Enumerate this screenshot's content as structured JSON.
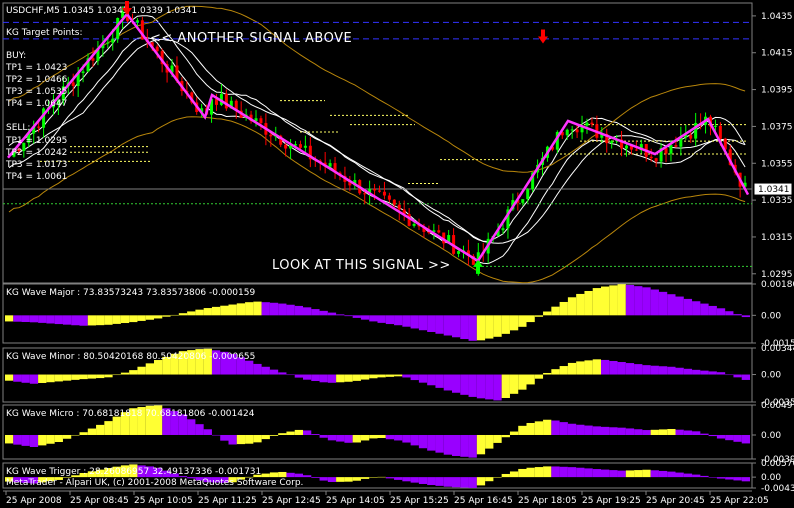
{
  "chart_data": [
    {
      "type": "candlestick",
      "title": "USDCHF,M5  1.0345 1.0345 1.0339 1.0341",
      "price_axis": {
        "ticks": [
          "1.0435",
          "1.0415",
          "1.0395",
          "1.0375",
          "1.0355",
          "1.0335",
          "1.0315",
          "1.0295"
        ],
        "ylim": [
          1.029,
          1.0442
        ],
        "current_price": "1.0341"
      },
      "target_box": {
        "title": "KG Target Points:",
        "buy_header": "BUY:",
        "buy": [
          "TP1 = 1.0423",
          "TP2 = 1.0466",
          "TP3 = 1.0535",
          "TP4 = 1.0647"
        ],
        "sell_header": "SELL:",
        "sell": [
          "TP1 = 1.0295",
          "TP2 = 1.0242",
          "TP3 = 1.0173",
          "TP4 = 1.0061"
        ]
      },
      "annotations": [
        "<< ANOTHER SIGNAL ABOVE",
        "LOOK AT THIS SIGNAL >>"
      ],
      "wave_pivots": [
        1.0358,
        1.0436,
        1.038,
        1.0392,
        1.0302,
        1.0378,
        1.036,
        1.0379,
        1.0338
      ],
      "colors": {
        "up": "#00ff00",
        "down": "#ff0000",
        "zigzag": "#ff33ff",
        "envelope": "#b8860b",
        "ma": "#ffffff",
        "levels": "#ffff66",
        "signal_up": "#00ff00",
        "signal_down": "#ff0000"
      }
    },
    {
      "type": "histogram",
      "title": "KG Wave Major : 73.83573243 73.83573806 -0.000159",
      "ticks": [
        "0.00180",
        "0.00",
        "-0.00159"
      ],
      "ylim": [
        -0.00159,
        0.0018
      ],
      "values": [
        -0.00035,
        -0.0004,
        -0.0005,
        -0.0006,
        -0.00055,
        -0.0004,
        -0.0002,
        0.0001,
        0.0004,
        0.0006,
        0.0008,
        0.0007,
        0.0005,
        0.0002,
        -0.0001,
        -0.0004,
        -0.0006,
        -0.0009,
        -0.0012,
        -0.0015,
        -0.0012,
        -0.0006,
        0.0003,
        0.0011,
        0.0016,
        0.0018,
        0.0016,
        0.0012,
        0.0008,
        0.0004,
        -0.0001
      ],
      "colors": {
        "rising": "#ffff33",
        "falling": "#9900ff"
      }
    },
    {
      "type": "histogram",
      "title": "KG Wave Minor : 80.50420168 80.50420806 -0.000655",
      "ticks": [
        "0.00344",
        "0.00",
        "-0.00356"
      ],
      "ylim": [
        -0.00356,
        0.00344
      ],
      "values": [
        -0.0008,
        -0.0012,
        -0.0009,
        -0.0006,
        -0.0004,
        0.0005,
        0.0018,
        0.003,
        0.0034,
        0.0028,
        0.0015,
        0.0004,
        -0.0006,
        -0.0011,
        -0.0009,
        -0.0004,
        -0.0002,
        -0.0012,
        -0.0022,
        -0.003,
        -0.0034,
        -0.0018,
        0.0004,
        0.0016,
        0.002,
        0.0016,
        0.0012,
        0.001,
        0.0006,
        0.0003,
        -0.0007
      ],
      "colors": {
        "rising": "#ffff33",
        "falling": "#9900ff"
      }
    },
    {
      "type": "histogram",
      "title": "KG Wave Micro : 70.68181818 70.68181806 -0.001424",
      "ticks": [
        "0.00497",
        "0.00",
        "-0.00398"
      ],
      "ylim": [
        -0.00398,
        0.00497
      ],
      "values": [
        -0.0014,
        -0.002,
        -0.0012,
        0.0004,
        0.0022,
        0.0044,
        0.005,
        0.0036,
        0.0012,
        -0.0016,
        -0.0014,
        0.0002,
        0.001,
        -0.0008,
        -0.0014,
        -0.0004,
        -0.001,
        -0.0024,
        -0.0034,
        -0.0038,
        -0.001,
        0.0018,
        0.0026,
        0.0018,
        0.0014,
        0.0012,
        0.0008,
        0.001,
        0.0006,
        -0.0006,
        -0.0014
      ],
      "colors": {
        "rising": "#ffff33",
        "falling": "#9900ff"
      }
    },
    {
      "type": "histogram",
      "title": "KG Wave Trigger : 28.26086957 32.49137336 -0.001731",
      "ticks": [
        "0.00570",
        "0.00",
        "-0.00439"
      ],
      "ylim": [
        -0.00439,
        0.0057
      ],
      "values": [
        -0.0018,
        -0.0026,
        -0.0012,
        0.0016,
        0.0036,
        0.0052,
        0.004,
        0.0006,
        -0.002,
        -0.0024,
        0.0008,
        0.0022,
        0.0012,
        -0.002,
        -0.0018,
        0.0004,
        -0.0014,
        -0.003,
        -0.004,
        -0.0044,
        0.0006,
        0.0036,
        0.0044,
        0.004,
        0.0032,
        0.0026,
        0.003,
        0.0022,
        0.001,
        -0.0006,
        -0.0017
      ],
      "colors": {
        "rising": "#ffff33",
        "falling": "#9900ff"
      }
    }
  ],
  "time_axis": [
    "25 Apr 2008",
    "25 Apr 08:45",
    "25 Apr 10:05",
    "25 Apr 11:25",
    "25 Apr 12:45",
    "25 Apr 14:05",
    "25 Apr 15:25",
    "25 Apr 16:45",
    "25 Apr 18:05",
    "25 Apr 19:25",
    "25 Apr 20:45",
    "25 Apr 22:05"
  ],
  "footer": "MetaTrader - Alpari UK, (c) 2001-2008 MetaQuotes Software Corp."
}
